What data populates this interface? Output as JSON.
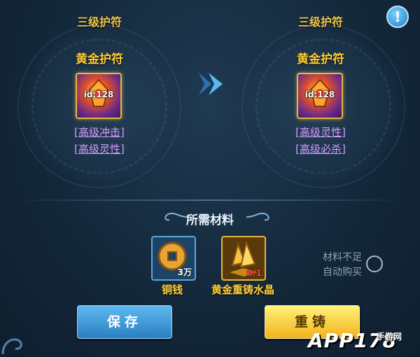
{
  "help_icon": "help-icon",
  "left": {
    "tier": "三级护符",
    "name": "黄金护符",
    "item_id": "id:128",
    "attrs": [
      "[高级冲击]",
      "[高级灵性]"
    ]
  },
  "right": {
    "tier": "三级护符",
    "name": "黄金护符",
    "item_id": "id:128",
    "attrs": [
      "[高级灵性]",
      "[高级必杀]"
    ]
  },
  "materials": {
    "title": "所需材料",
    "items": [
      {
        "name": "铜钱",
        "qty": "3万",
        "icon": "coin-icon"
      },
      {
        "name": "黄金重铸水晶",
        "qty": "0/1",
        "icon": "crystal-icon"
      }
    ],
    "auto_buy_line1": "材料不足",
    "auto_buy_line2": "自动购买"
  },
  "buttons": {
    "save": "保存",
    "recast": "重铸"
  },
  "watermark": {
    "main": "APP178",
    "sub": "手游网"
  },
  "colors": {
    "accent_gold": "#ffcc33",
    "attr_purple": "#d59cff",
    "save_blue": "#2a7fc0",
    "recast_yellow": "#f2b21c"
  }
}
